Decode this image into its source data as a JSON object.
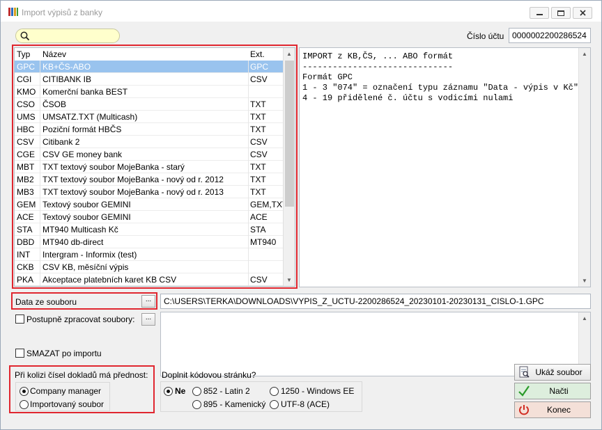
{
  "window": {
    "title": "Import výpisů z banky"
  },
  "account": {
    "label": "Číslo účtu",
    "value": "0000002200286524"
  },
  "list": {
    "headers": {
      "typ": "Typ",
      "nazev": "Název",
      "ext": "Ext."
    },
    "rows": [
      {
        "typ": "GPC",
        "nazev": "KB+ČS-ABO",
        "ext": "GPC",
        "selected": true
      },
      {
        "typ": "CGI",
        "nazev": "CITIBANK IB",
        "ext": "CSV"
      },
      {
        "typ": "KMO",
        "nazev": "Komerční banka BEST",
        "ext": ""
      },
      {
        "typ": "CSO",
        "nazev": "ČSOB",
        "ext": "TXT"
      },
      {
        "typ": "UMS",
        "nazev": "UMSATZ.TXT (Multicash)",
        "ext": "TXT"
      },
      {
        "typ": "HBC",
        "nazev": "Poziční formát HBČS",
        "ext": "TXT"
      },
      {
        "typ": "CSV",
        "nazev": "Citibank 2",
        "ext": "CSV"
      },
      {
        "typ": "CGE",
        "nazev": "CSV GE money bank",
        "ext": "CSV"
      },
      {
        "typ": "MBT",
        "nazev": "TXT textový soubor MojeBanka - starý",
        "ext": "TXT"
      },
      {
        "typ": "MB2",
        "nazev": "TXT textový soubor MojeBanka - nový od r. 2012",
        "ext": "TXT"
      },
      {
        "typ": "MB3",
        "nazev": "TXT textový soubor MojeBanka - nový od r. 2013",
        "ext": "TXT"
      },
      {
        "typ": "GEM",
        "nazev": "Textový soubor GEMINI",
        "ext": "GEM,TXT"
      },
      {
        "typ": "ACE",
        "nazev": "Textový soubor GEMINI",
        "ext": "ACE"
      },
      {
        "typ": "STA",
        "nazev": "MT940 Multicash Kč",
        "ext": "STA"
      },
      {
        "typ": "DBD",
        "nazev": "MT940 db-direct",
        "ext": "MT940"
      },
      {
        "typ": "INT",
        "nazev": "Intergram - Informix (test)",
        "ext": ""
      },
      {
        "typ": "CKB",
        "nazev": "CSV KB, měsíční výpis",
        "ext": ""
      },
      {
        "typ": "PKA",
        "nazev": "Akceptace platebních karet KB CSV",
        "ext": "CSV"
      }
    ]
  },
  "info": {
    "text": "IMPORT z KB,ČS, ... ABO formát\n------------------------------\nFormát GPC\n1 - 3 \"074\" = označení typu záznamu \"Data - výpis v Kč\"\n4 - 19 přidělené č. účtu s vodicími nulami"
  },
  "data_source": {
    "label": "Data ze souboru",
    "browse": "...",
    "path": "C:\\USERS\\TERKA\\DOWNLOADS\\VYPIS_Z_UCTU-2200286524_20230101-20230131_CISLO-1.GPC"
  },
  "progressive": {
    "label": "Postupně zpracovat soubory:",
    "browse": "..."
  },
  "delete_after": {
    "label": "SMAZAT po importu"
  },
  "conflict": {
    "label": "Při kolizi čísel dokladů má přednost:",
    "options": [
      "Company manager",
      "Importovaný soubor"
    ],
    "selected": 0
  },
  "codepage": {
    "label": "Doplnit kódovou stránku?",
    "options": [
      "Ne",
      "852 - Latin 2",
      "1250 - Windows EE",
      "895 - Kamenický",
      "UTF-8 (ACE)"
    ],
    "selected": 0
  },
  "buttons": {
    "show_file": "Ukáž soubor",
    "load": "Načti",
    "end": "Konec"
  },
  "colors": {
    "highlight": "#e0262f",
    "selection": "#99c3ee",
    "search_bg": "#ffffcc"
  },
  "icons": {
    "search": "search-icon",
    "app": "app-icon",
    "show_file": "document-icon",
    "load": "check-icon",
    "end": "power-icon"
  }
}
